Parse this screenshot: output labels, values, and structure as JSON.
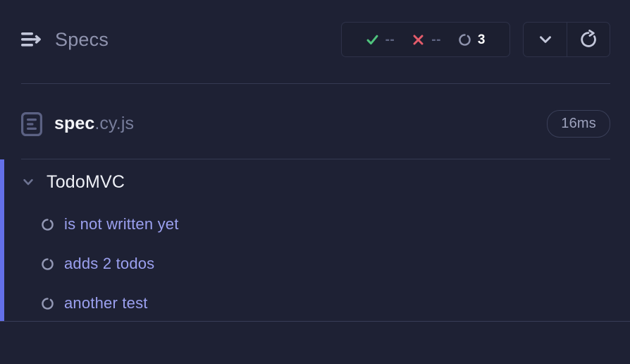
{
  "header": {
    "title": "Specs",
    "menu_icon": "specs-arrow-icon",
    "stats": [
      {
        "id": "passed",
        "icon": "check-icon",
        "value": "--",
        "color": "#4fc37d",
        "active": false
      },
      {
        "id": "failed",
        "icon": "x-icon",
        "value": "--",
        "color": "#e45c6b",
        "active": false
      },
      {
        "id": "pending",
        "icon": "pending-icon",
        "value": "3",
        "color": "#8e93ad",
        "active": true
      }
    ],
    "buttons": [
      {
        "id": "collapse-all",
        "icon": "chevron-down-icon"
      },
      {
        "id": "rerun",
        "icon": "refresh-icon"
      }
    ]
  },
  "spec": {
    "icon": "file-document-icon",
    "name_base": "spec",
    "name_ext": ".cy.js",
    "duration": "16ms"
  },
  "results": {
    "accent_color": "#6470e8",
    "suites": [
      {
        "name": "TodoMVC",
        "expanded": true,
        "chevron_icon": "chevron-down-icon",
        "tests": [
          {
            "name": "is not written yet",
            "status": "pending",
            "icon": "pending-icon"
          },
          {
            "name": "adds 2 todos",
            "status": "pending",
            "icon": "pending-icon"
          },
          {
            "name": "another test",
            "status": "pending",
            "icon": "pending-icon"
          }
        ]
      }
    ]
  },
  "colors": {
    "background": "#1e2134",
    "accent": "#6470e8",
    "pass": "#4fc37d",
    "fail": "#e45c6b",
    "pending_text": "#9ba0ef"
  }
}
